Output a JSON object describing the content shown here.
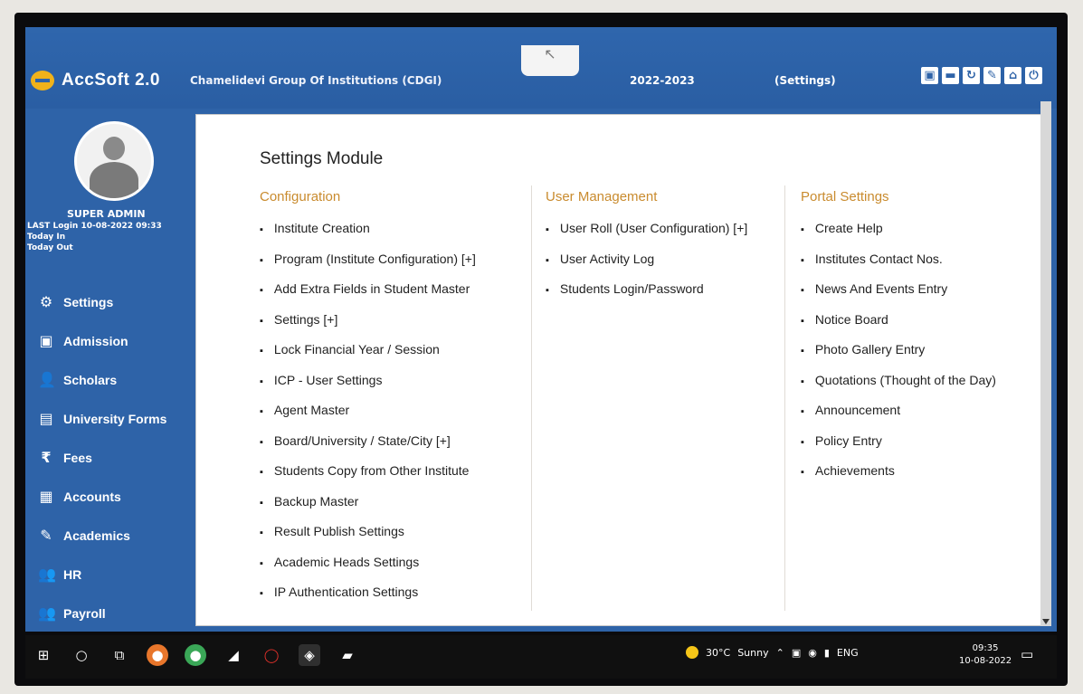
{
  "app": {
    "title": "AccSoft 2.0",
    "organization": "Chamelidevi Group Of Institutions (CDGI)",
    "session": "2022-2023",
    "current_page": "(Settings)"
  },
  "profile": {
    "role": "SUPER ADMIN",
    "last_login": "LAST Login 10-08-2022 09:33",
    "today_in": "Today In",
    "today_out": "Today Out"
  },
  "sidebar": {
    "items": [
      {
        "icon": "gear-icon",
        "glyph": "⚙",
        "label": "Settings"
      },
      {
        "icon": "admission-icon",
        "glyph": "▣",
        "label": "Admission"
      },
      {
        "icon": "scholars-icon",
        "glyph": "👤",
        "label": "Scholars"
      },
      {
        "icon": "forms-icon",
        "glyph": "▤",
        "label": "University Forms"
      },
      {
        "icon": "rupee-icon",
        "glyph": "₹",
        "label": "Fees"
      },
      {
        "icon": "accounts-icon",
        "glyph": "▦",
        "label": "Accounts"
      },
      {
        "icon": "academics-icon",
        "glyph": "✎",
        "label": "Academics"
      },
      {
        "icon": "hr-icon",
        "glyph": "👥",
        "label": "HR"
      },
      {
        "icon": "payroll-icon",
        "glyph": "👥",
        "label": "Payroll"
      }
    ]
  },
  "main": {
    "module_title": "Settings Module",
    "columns": [
      {
        "heading": "Configuration",
        "items": [
          "Institute Creation",
          "Program (Institute Configuration) [+]",
          "Add Extra Fields in Student Master",
          "Settings [+]",
          "Lock Financial Year / Session",
          "ICP - User Settings",
          "Agent Master",
          "Board/University / State/City [+]",
          "Students Copy from Other Institute",
          "Backup Master",
          "Result Publish Settings",
          "Academic Heads Settings",
          "IP Authentication Settings"
        ]
      },
      {
        "heading": "User Management",
        "items": [
          "User Roll (User Configuration) [+]",
          "User Activity Log",
          "Students Login/Password"
        ]
      },
      {
        "heading": "Portal Settings",
        "items": [
          "Create Help",
          "Institutes Contact Nos.",
          "News And Events Entry",
          "Notice Board",
          "Photo Gallery Entry",
          "Quotations (Thought of the Day)",
          "Announcement",
          "Policy Entry",
          "Achievements"
        ]
      }
    ]
  },
  "taskbar": {
    "weather_temp": "30°C",
    "weather_text": "Sunny",
    "language": "ENG",
    "time": "09:35",
    "date": "10-08-2022"
  },
  "colors": {
    "brand_blue": "#2e63a8",
    "heading_gold": "#c98b2e"
  }
}
